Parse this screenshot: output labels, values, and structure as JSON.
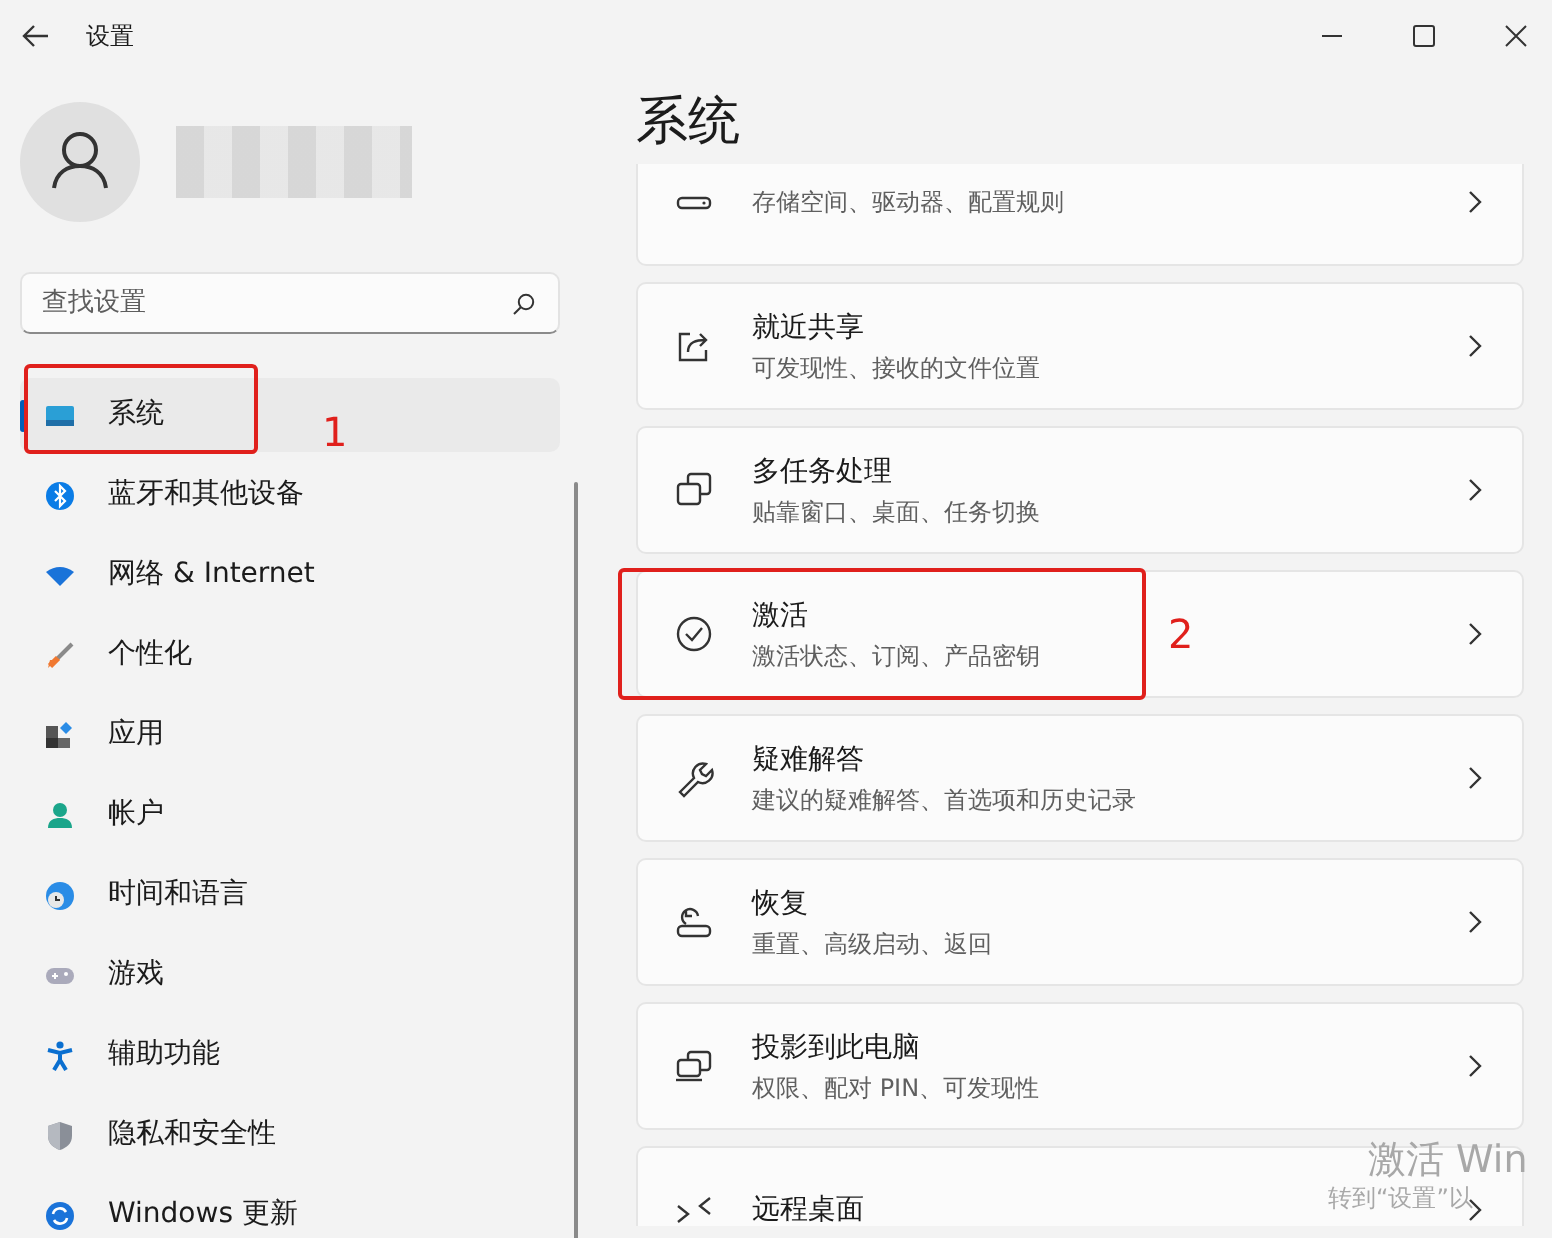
{
  "window": {
    "title": "设置"
  },
  "search": {
    "placeholder": "查找设置"
  },
  "nav": [
    {
      "label": "系统",
      "selected": true,
      "annotation": "1"
    },
    {
      "label": "蓝牙和其他设备",
      "selected": false
    },
    {
      "label": "网络 & Internet",
      "selected": false
    },
    {
      "label": "个性化",
      "selected": false
    },
    {
      "label": "应用",
      "selected": false
    },
    {
      "label": "帐户",
      "selected": false
    },
    {
      "label": "时间和语言",
      "selected": false
    },
    {
      "label": "游戏",
      "selected": false
    },
    {
      "label": "辅助功能",
      "selected": false
    },
    {
      "label": "隐私和安全性",
      "selected": false
    },
    {
      "label": "Windows 更新",
      "selected": false
    }
  ],
  "page_title": "系统",
  "cards": [
    {
      "subtitle": "存储空间、驱动器、配置规则"
    },
    {
      "title": "就近共享",
      "subtitle": "可发现性、接收的文件位置"
    },
    {
      "title": "多任务处理",
      "subtitle": "贴靠窗口、桌面、任务切换"
    },
    {
      "title": "激活",
      "subtitle": "激活状态、订阅、产品密钥",
      "annotation": "2"
    },
    {
      "title": "疑难解答",
      "subtitle": "建议的疑难解答、首选项和历史记录"
    },
    {
      "title": "恢复",
      "subtitle": "重置、高级启动、返回"
    },
    {
      "title": "投影到此电脑",
      "subtitle": "权限、配对 PIN、可发现性"
    },
    {
      "title": "远程桌面"
    }
  ],
  "activation_watermark": {
    "title": "激活 Win",
    "subtitle": "转到“设置”以"
  }
}
